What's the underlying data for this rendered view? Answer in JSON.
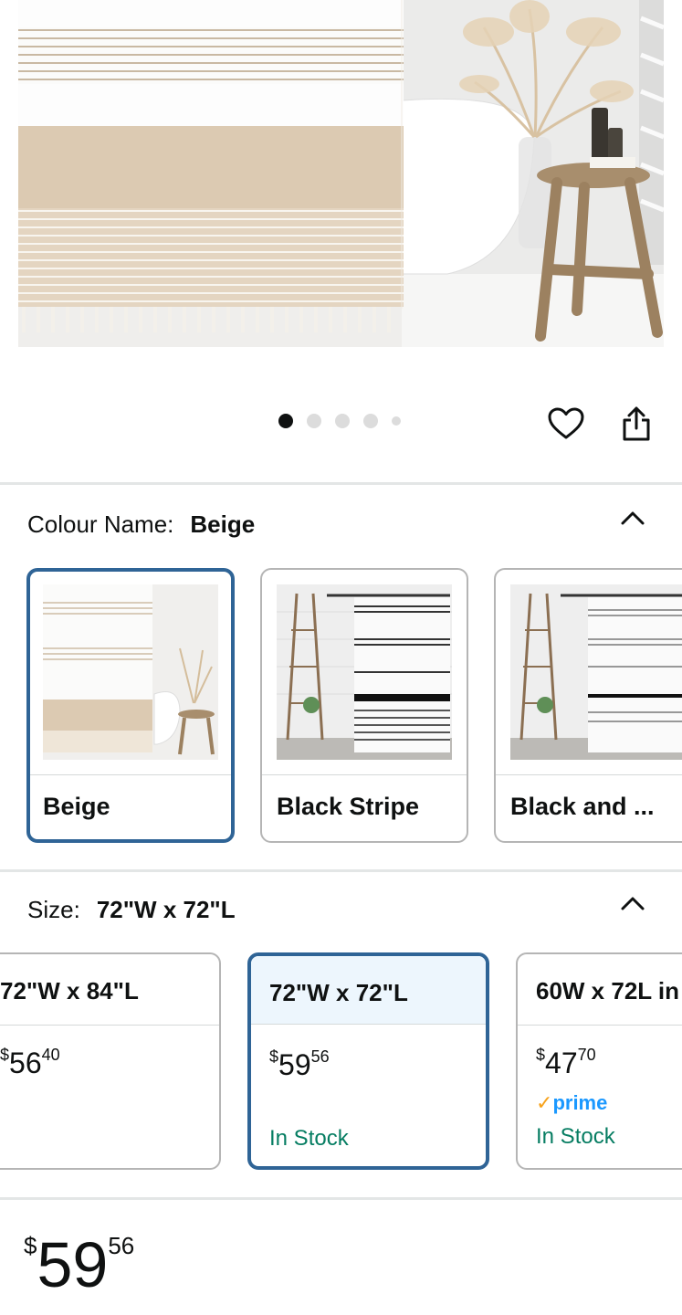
{
  "gallery": {
    "image_count": 5,
    "active_index": 0
  },
  "actions": {
    "wishlist_icon": "heart-icon",
    "share_icon": "share-icon"
  },
  "colour": {
    "label": "Colour Name:",
    "selected": "Beige",
    "options": [
      {
        "label": "Beige",
        "selected": true
      },
      {
        "label": "Black Stripe",
        "selected": false
      },
      {
        "label": "Black and ...",
        "selected": false
      }
    ]
  },
  "size": {
    "label": "Size:",
    "selected": "72\"W x 72\"L",
    "options": [
      {
        "label": "72\"W x 84\"L",
        "currency": "$",
        "price_main": "56",
        "price_cents": "40",
        "prime": "",
        "stock": "",
        "selected": false
      },
      {
        "label": "72\"W x 72\"L",
        "currency": "$",
        "price_main": "59",
        "price_cents": "56",
        "prime": "",
        "stock": "In Stock",
        "selected": true
      },
      {
        "label": "60W x 72L in",
        "currency": "$",
        "price_main": "47",
        "price_cents": "70",
        "prime": "prime",
        "stock": "In Stock",
        "selected": false
      }
    ]
  },
  "price": {
    "currency": "$",
    "main": "59",
    "cents": "56"
  },
  "colors": {
    "selected_border": "#2f6496",
    "in_stock": "#067d62",
    "prime": "#1a98ff"
  }
}
